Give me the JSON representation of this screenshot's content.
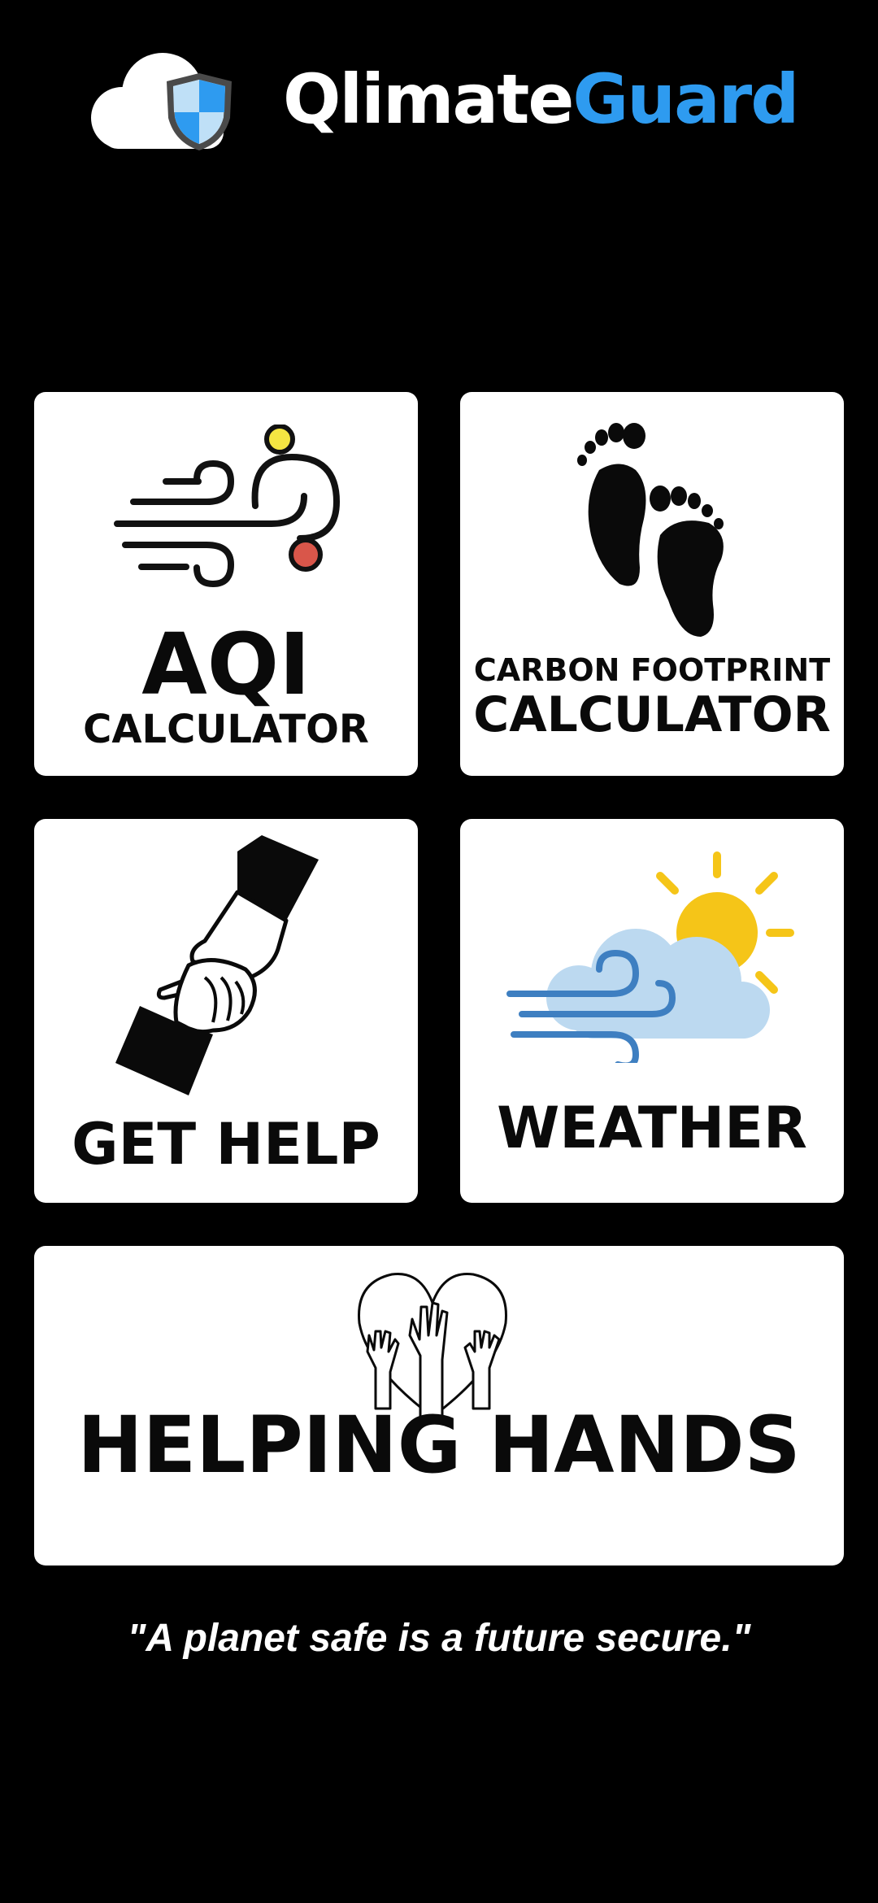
{
  "app": {
    "logo_part1": "Qlimate",
    "logo_part2": "Guard",
    "brand_color": "#2e9bf0"
  },
  "tiles": [
    {
      "id": "aqi",
      "label_main": "AQI",
      "label_sub": "CALCULATOR",
      "icon": "wind-air-quality-icon"
    },
    {
      "id": "carbon",
      "label_top": "CARBON FOOTPRINT",
      "label_main": "CALCULATOR",
      "icon": "footprints-icon"
    },
    {
      "id": "help",
      "label_main": "GET HELP",
      "icon": "helping-hand-icon"
    },
    {
      "id": "weather",
      "label_main": "WEATHER",
      "icon": "sun-cloud-wind-icon"
    },
    {
      "id": "hands",
      "label_main": "HELPING HANDS",
      "icon": "heart-raised-hands-icon"
    }
  ],
  "quote": "\"A planet safe is a future secure.\""
}
